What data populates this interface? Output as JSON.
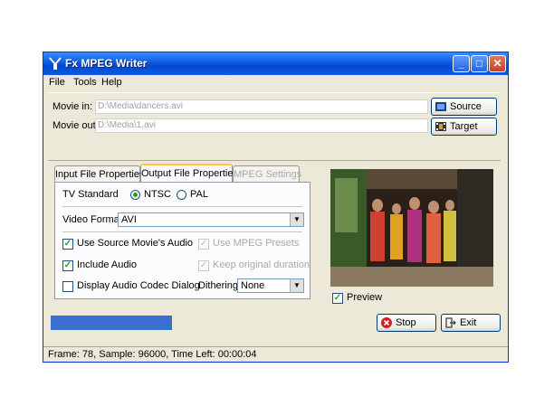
{
  "window": {
    "title": "Fx MPEG Writer"
  },
  "menu": [
    "File",
    "Tools",
    "Help"
  ],
  "io": {
    "movie_in_label": "Movie in:",
    "movie_in_value": "D:\\Media\\dancers.avi",
    "movie_out_label": "Movie out:",
    "movie_out_value": "D:\\Media\\1.avi",
    "source_label": "Source",
    "target_label": "Target"
  },
  "tabs": [
    "Input File Properties",
    "Output File Properties",
    "MPEG Settings"
  ],
  "output": {
    "tv_standard_label": "TV Standard",
    "ntsc_label": "NTSC",
    "pal_label": "PAL",
    "video_format_label": "Video Format",
    "video_format_value": "AVI",
    "use_source_audio_label": "Use Source Movie's Audio",
    "use_mpeg_presets_label": "Use MPEG Presets",
    "include_audio_label": "Include Audio",
    "keep_duration_label": "Keep original duration",
    "display_codec_label": "Display Audio  Codec Dialog",
    "dithering_label": "Dithering",
    "dithering_value": "None"
  },
  "preview": {
    "label": "Preview"
  },
  "progress": {
    "fraction": 0.47
  },
  "actions": {
    "stop_label": "Stop",
    "exit_label": "Exit"
  },
  "status": {
    "text": "Frame:  78, Sample:  96000, Time Left: 00:00:04"
  },
  "colors": {
    "titlebar": "#0a5ce0",
    "accent_tab": "#ffc83c",
    "progress": "#3a6fd0"
  }
}
